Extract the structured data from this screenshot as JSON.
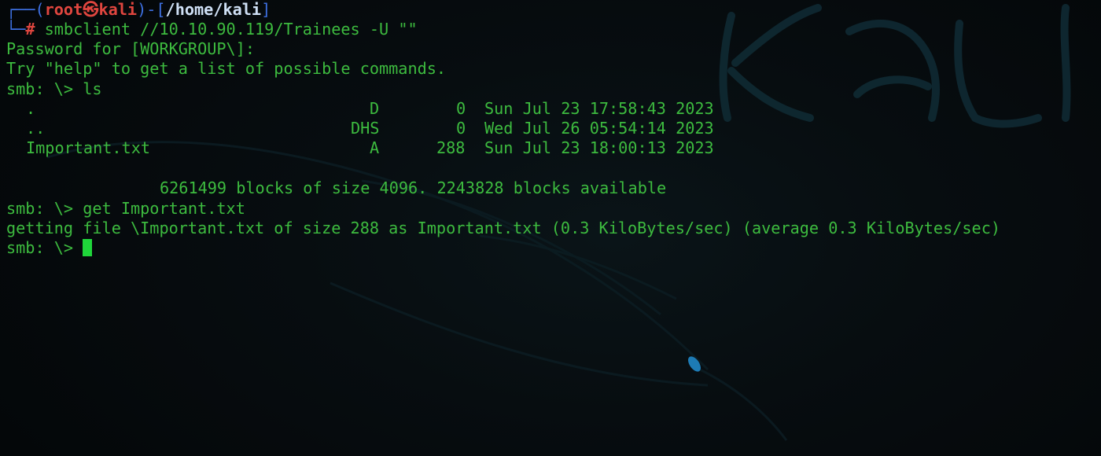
{
  "background_watermark": "KALI",
  "prompt": {
    "user": "root",
    "skull": "㉿",
    "host": "kali",
    "path": "/home/kali",
    "hash": "#"
  },
  "command1": "smbclient //10.10.90.119/Trainees -U \"\"",
  "output": {
    "password_prompt": "Password for [WORKGROUP\\]:",
    "help_hint": "Try \"help\" to get a list of possible commands.",
    "smb_ls": "smb: \\> ls"
  },
  "listing": [
    {
      "name": ".",
      "attr": "D",
      "size": "0",
      "date": "Sun Jul 23 17:58:43 2023"
    },
    {
      "name": "..",
      "attr": "DHS",
      "size": "0",
      "date": "Wed Jul 26 05:54:14 2023"
    },
    {
      "name": "Important.txt",
      "attr": "A",
      "size": "288",
      "date": "Sun Jul 23 18:00:13 2023"
    }
  ],
  "blocks_info": "6261499 blocks of size 4096. 2243828 blocks available",
  "smb_get": "smb: \\> get Important.txt",
  "getting_file": "getting file \\Important.txt of size 288 as Important.txt (0.3 KiloBytes/sec) (average 0.3 KiloBytes/sec)",
  "smb_prompt_final": "smb: \\> ",
  "colors": {
    "text_green": "#3dbb3f",
    "prompt_blue": "#3d6fe0",
    "prompt_red": "#e0463f",
    "cursor": "#1fd63a",
    "background": "#05090b"
  }
}
